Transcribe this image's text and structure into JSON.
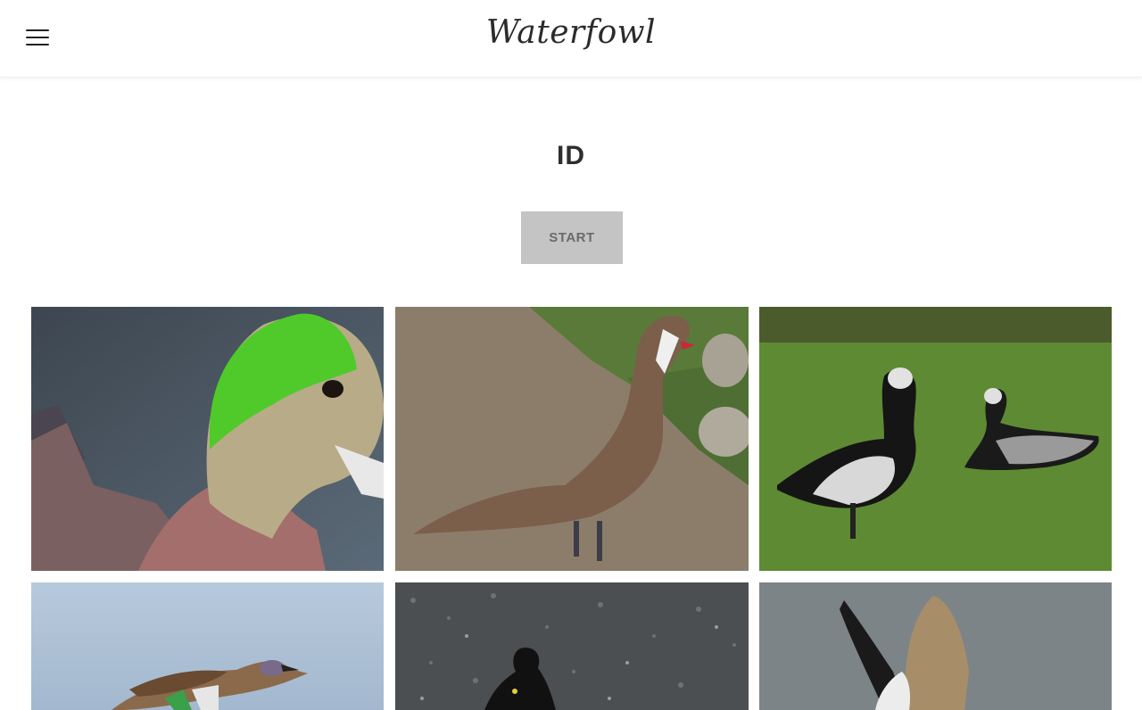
{
  "header": {
    "site_title": "Waterfowl",
    "menu_icon": "hamburger-menu-icon"
  },
  "main": {
    "heading": "ID",
    "start_label": "START",
    "start_button_color": "#c4c4c4"
  },
  "gallery": {
    "tiles": [
      {
        "subject": "American wigeon drake close-up"
      },
      {
        "subject": "White-cheeked pintail standing on ground"
      },
      {
        "subject": "Two barnacle geese on grass"
      },
      {
        "subject": "Blue-winged teal in flight"
      },
      {
        "subject": "Black scoter on water"
      },
      {
        "subject": "Goose spreading wings"
      }
    ]
  }
}
